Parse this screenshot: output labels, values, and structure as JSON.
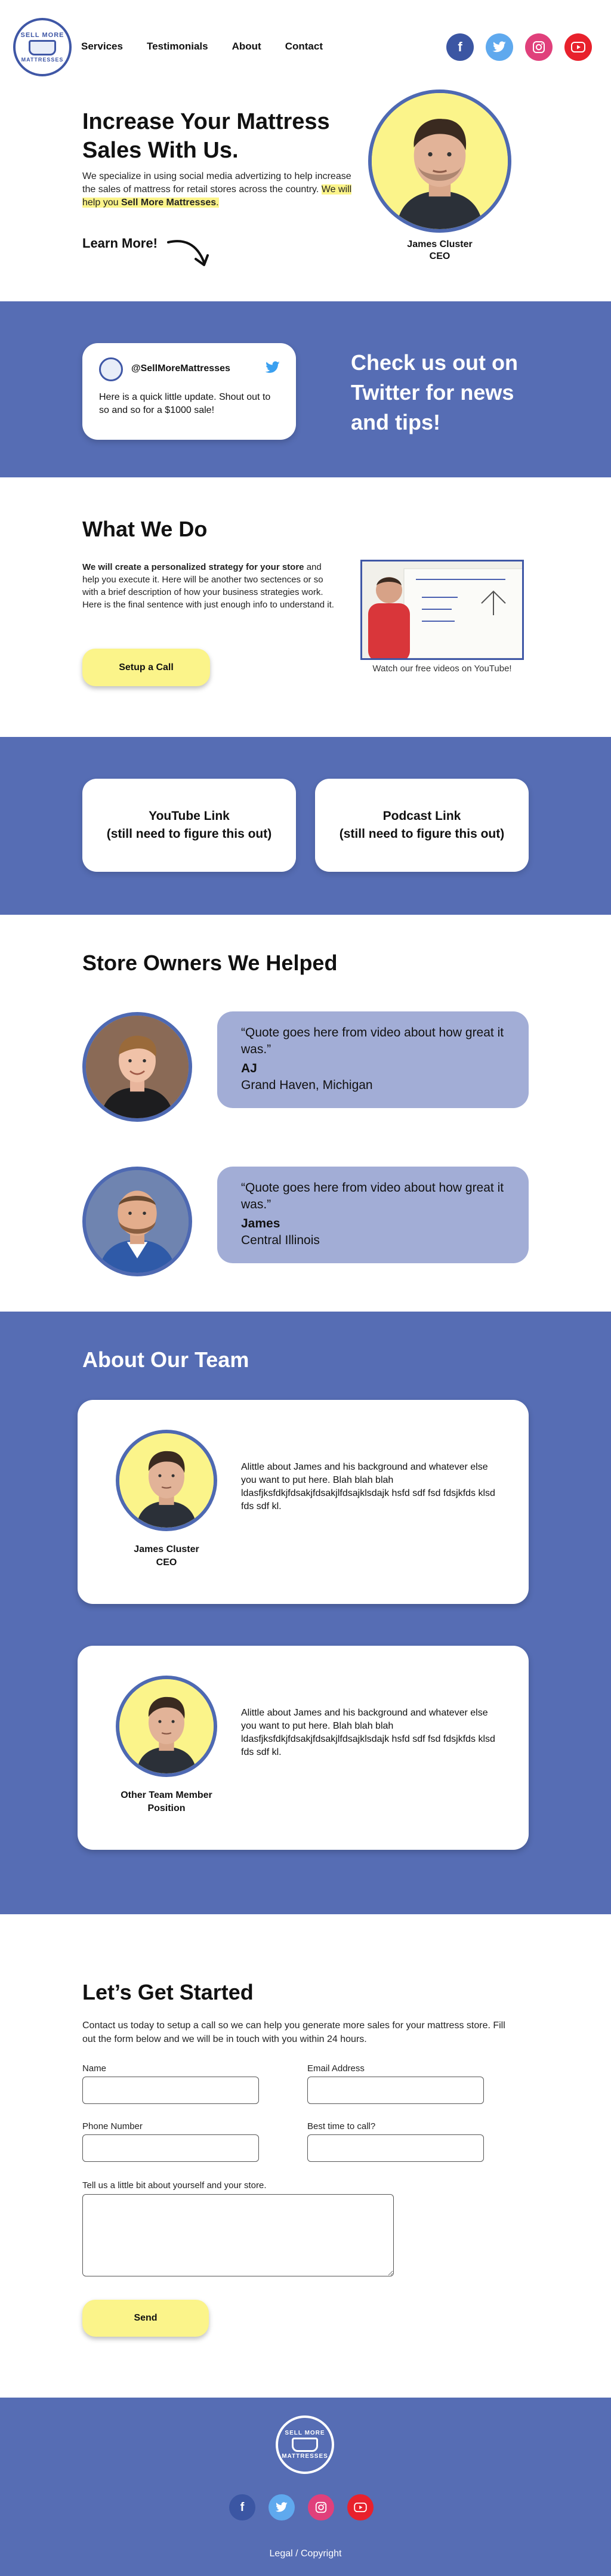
{
  "nav": {
    "logo_top": "SELL MORE",
    "logo_bottom": "MATTRESSES",
    "links": [
      "Services",
      "Testimonials",
      "About",
      "Contact"
    ],
    "social": [
      {
        "icon": "facebook-icon",
        "glyph": "f",
        "color": "#3b56a3"
      },
      {
        "icon": "twitter-icon",
        "glyph": "t",
        "color": "#5fa9ee"
      },
      {
        "icon": "instagram-icon",
        "glyph": "◎",
        "color": "#e0407b"
      },
      {
        "icon": "youtube-icon",
        "glyph": "▶",
        "color": "#e8212c"
      }
    ]
  },
  "hero": {
    "title": "Increase Your Mattress Sales With Us.",
    "body": "We specialize in using social media advertizing to help increase the sales of mattress for retail stores across the country.",
    "highlight_prefix": "We will help you",
    "highlight_bold": "Sell More Mattresses",
    "highlight_suffix": ".",
    "learn_more": "Learn More!",
    "person_name": "James Cluster",
    "person_role": "CEO"
  },
  "twitter": {
    "handle": "@SellMoreMattresses",
    "tweet": "Here is a quick little update. Shout out to so and so for a $1000 sale!",
    "heading": "Check us out on Twitter for news and tips!"
  },
  "what_we_do": {
    "title": "What We Do",
    "body_bold": "We will create a personalized strategy for your store",
    "body_rest": "and help you execute it. Here will be another two sectences or so with a brief description of how your business strategies work. Here is the final sentence with just enough info to understand it.",
    "button": "Setup a Call",
    "video_caption": "Watch our free videos on YouTube!"
  },
  "links": {
    "youtube": "YouTube Link",
    "youtube_note": "(still need to figure this out)",
    "podcast": "Podcast Link",
    "podcast_note": "(still need to figure this out)"
  },
  "owners": {
    "title": "Store Owners We Helped",
    "items": [
      {
        "quote": "“Quote goes here from video about how great it was.”",
        "name": "AJ",
        "location": "Grand Haven, Michigan"
      },
      {
        "quote": "“Quote goes here from video about how great it was.”",
        "name": "James",
        "location": "Central Illinois"
      }
    ]
  },
  "team": {
    "title": "About Our Team",
    "members": [
      {
        "name": "James Cluster",
        "role": "CEO",
        "bio": "Alittle about James and his background and whatever else you want to put here. Blah blah blah ldasfjksfdkjfdsakjfdsakjlfdsajklsdajk hsfd  sdf fsd fdsjkfds klsd fds sdf kl."
      },
      {
        "name": "Other Team Member",
        "role": "Position",
        "bio": "Alittle about James and his background and whatever else you want to put here. Blah blah blah ldasfjksfdkjfdsakjfdsakjlfdsajklsdajk hsfd  sdf fsd fdsjkfds klsd fds sdf kl."
      }
    ]
  },
  "form": {
    "title": "Let’s Get Started",
    "intro": "Contact us today to setup a call so we can help you generate more sales for your mattress store. Fill out the form below and we will be in touch with you within 24 hours.",
    "name_label": "Name",
    "email_label": "Email Address",
    "phone_label": "Phone Number",
    "time_label": "Best time to call?",
    "about_label": "Tell us a little bit about yourself and your store.",
    "submit": "Send"
  },
  "footer": {
    "logo_top": "SELL MORE",
    "logo_bottom": "MATTRESSES",
    "legal": "Legal / Copyright"
  },
  "colors": {
    "brand_blue": "#566db4",
    "accent_yellow": "#fbf48a",
    "quote_bg": "#a2add6"
  }
}
